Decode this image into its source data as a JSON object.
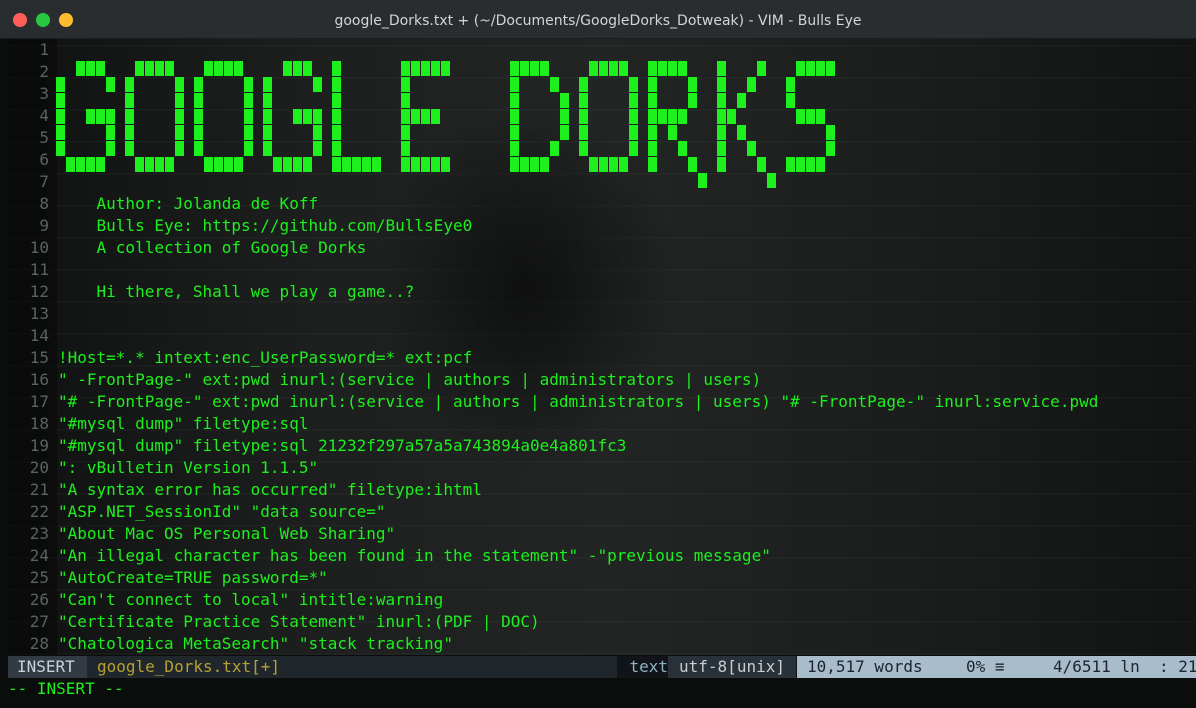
{
  "window": {
    "title": "google_Dorks.txt + (~/Documents/GoogleDorks_Dotweak) - VIM - Bulls Eye"
  },
  "colors": {
    "text": "#1df01d",
    "line_number": "#5c6360",
    "status_mode_bg": "#323b43",
    "status_right_bg": "#a9bccc"
  },
  "banner": {
    "text": "GOOGLE DORKS",
    "style": "pixel-ascii-art",
    "color": "#1df01d"
  },
  "editor": {
    "line_numbers": [
      "1",
      "2",
      "3",
      "4",
      "5",
      "6",
      "7",
      "8",
      "9",
      "10",
      "11",
      "12",
      "13",
      "14",
      "15",
      "16",
      "17",
      "18",
      "19",
      "20",
      "21",
      "22",
      "23",
      "24",
      "25",
      "26",
      "27",
      "28"
    ],
    "lines": [
      "",
      "",
      "",
      "",
      "",
      "",
      "",
      "    Author: Jolanda de Koff",
      "    Bulls Eye: https://github.com/BullsEye0",
      "    A collection of Google Dorks",
      "",
      "    Hi there, Shall we play a game..?",
      "",
      "",
      "!Host=*.* intext:enc_UserPassword=* ext:pcf",
      "\" -FrontPage-\" ext:pwd inurl:(service | authors | administrators | users)",
      "\"# -FrontPage-\" ext:pwd inurl:(service | authors | administrators | users) \"# -FrontPage-\" inurl:service.pwd",
      "\"#mysql dump\" filetype:sql",
      "\"#mysql dump\" filetype:sql 21232f297a57a5a743894a0e4a801fc3",
      "\": vBulletin Version 1.1.5\"",
      "\"A syntax error has occurred\" filetype:ihtml",
      "\"ASP.NET_SessionId\" \"data source=\"",
      "\"About Mac OS Personal Web Sharing\"",
      "\"An illegal character has been found in the statement\" -\"previous message\"",
      "\"AutoCreate=TRUE password=*\"",
      "\"Can't connect to local\" intitle:warning",
      "\"Certificate Practice Statement\" inurl:(PDF | DOC)",
      "\"Chatologica MetaSearch\" \"stack tracking\""
    ]
  },
  "statusbar": {
    "mode": "INSERT",
    "filename": "google_Dorks.txt[+]",
    "filetype": "text",
    "encoding": "utf-8[unix]",
    "words": "10,517 words",
    "percent": "0% ≡",
    "position": "4/6511 ln  : 21"
  },
  "cmdline": {
    "text": "-- INSERT --"
  }
}
